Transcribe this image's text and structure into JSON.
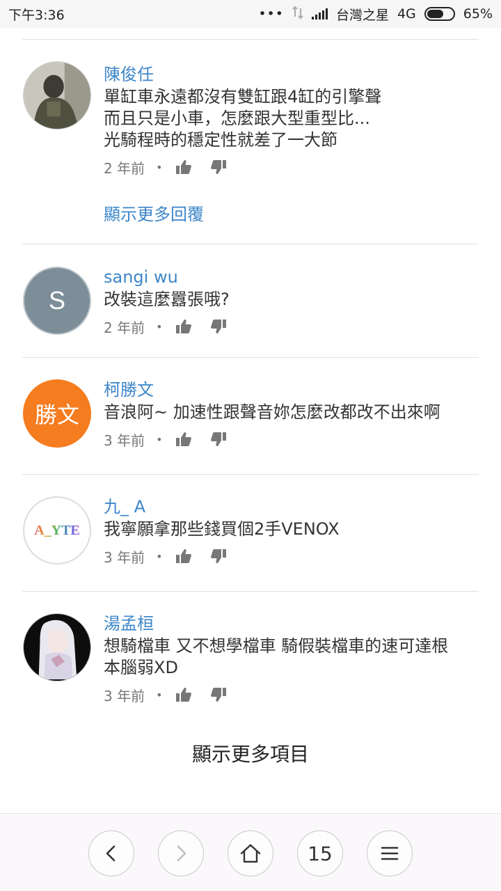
{
  "status_bar": {
    "time": "下午3:36",
    "dots": "•••",
    "carrier": "台灣之星",
    "network": "4G",
    "battery_percent": "65%",
    "battery_level": 0.65
  },
  "comments": [
    {
      "author": "陳俊任",
      "lines": [
        "單缸車永遠都沒有雙缸跟4缸的引擎聲",
        "而且只是小車，怎麼跟大型重型比...",
        "光騎程時的穩定性就差了一大節"
      ],
      "time": "2 年前",
      "avatar": {
        "type": "photo",
        "icon": "soldier-photo"
      }
    },
    {
      "author": "sangi wu",
      "lines": [
        "改裝這麼囂張哦?"
      ],
      "time": "2 年前",
      "avatar": {
        "type": "letter",
        "text": "S",
        "color": "#7d8e99"
      }
    },
    {
      "author": "柯勝文",
      "lines": [
        "音浪阿~ 加速性跟聲音妳怎麼改都改不出來啊"
      ],
      "time": "3 年前",
      "avatar": {
        "type": "letter",
        "text": "勝文",
        "color": "#f57c1f"
      }
    },
    {
      "author": "九_ A",
      "lines": [
        "我寧願拿那些錢買個2手VENOX"
      ],
      "time": "3 年前",
      "avatar": {
        "type": "logo",
        "text": "A_YTE",
        "color": "#ffffff"
      }
    },
    {
      "author": "湯孟桓",
      "lines": [
        "想騎檔車 又不想學檔車 騎假裝檔車的速可達根",
        "本腦弱XD"
      ],
      "time": "3 年前",
      "avatar": {
        "type": "photo",
        "icon": "anime-girl-photo"
      }
    }
  ],
  "show_more_replies": "顯示更多回覆",
  "show_more_items": "顯示更多項目",
  "nav": {
    "tab_count": "15",
    "icons": [
      "back-icon",
      "forward-icon",
      "home-icon",
      "tabs-count",
      "menu-icon"
    ]
  }
}
